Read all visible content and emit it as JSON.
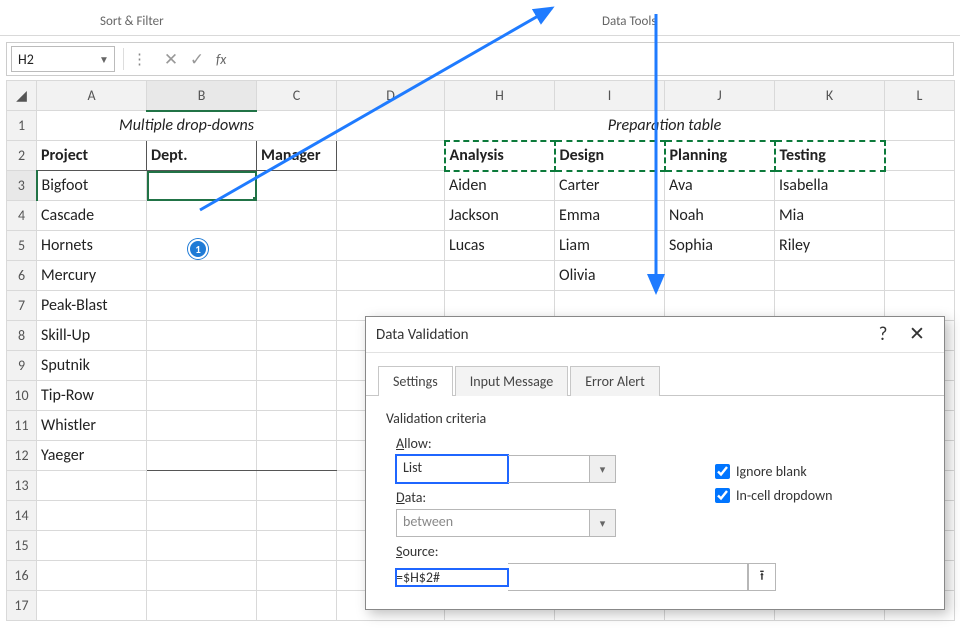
{
  "ribbon": {
    "group_sortfilter": "Sort & Filter",
    "group_datatools": "Data Tools"
  },
  "namebox": {
    "value": "H2"
  },
  "fx": {
    "label": "fx"
  },
  "headings": {
    "multiple_title": "Multiple drop-downs",
    "prep_title": "Preparation table",
    "cols": [
      "",
      "A",
      "B",
      "C",
      "D",
      "H",
      "I",
      "J",
      "K",
      "L"
    ],
    "project": "Project",
    "dept": "Dept.",
    "manager": "Manager",
    "analysis": "Analysis",
    "design": "Design",
    "planning": "Planning",
    "testing": "Testing"
  },
  "projects": [
    "Bigfoot",
    "Cascade",
    "Hornets",
    "Mercury",
    "Peak-Blast",
    "Skill-Up",
    "Sputnik",
    "Tip-Row",
    "Whistler",
    "Yaeger"
  ],
  "prep": {
    "analysis": [
      "Aiden",
      "Jackson",
      "Lucas"
    ],
    "design": [
      "Carter",
      "Emma",
      "Liam",
      "Olivia"
    ],
    "planning": [
      "Ava",
      "Noah",
      "Sophia"
    ],
    "testing": [
      "Isabella",
      "Mia",
      "Riley"
    ]
  },
  "rownums": [
    "1",
    "2",
    "3",
    "4",
    "5",
    "6",
    "7",
    "8",
    "9",
    "10",
    "11",
    "12",
    "13",
    "14",
    "15",
    "16",
    "17"
  ],
  "badge1": "1",
  "dialog": {
    "title": "Data Validation",
    "help": "?",
    "close": "✕",
    "tabs": {
      "settings": "Settings",
      "input": "Input Message",
      "error": "Error Alert"
    },
    "criteria_label": "Validation criteria",
    "allow_label": "Allow:",
    "allow_value": "List",
    "data_label": "Data:",
    "data_value": "between",
    "source_label": "Source:",
    "source_value": "=$H$2#",
    "ignore_blank": "Ignore blank",
    "incell": "In-cell dropdown",
    "accel_allow": "A",
    "accel_data": "D",
    "accel_source": "S",
    "accel_blank": "b",
    "accel_incell": "I"
  }
}
